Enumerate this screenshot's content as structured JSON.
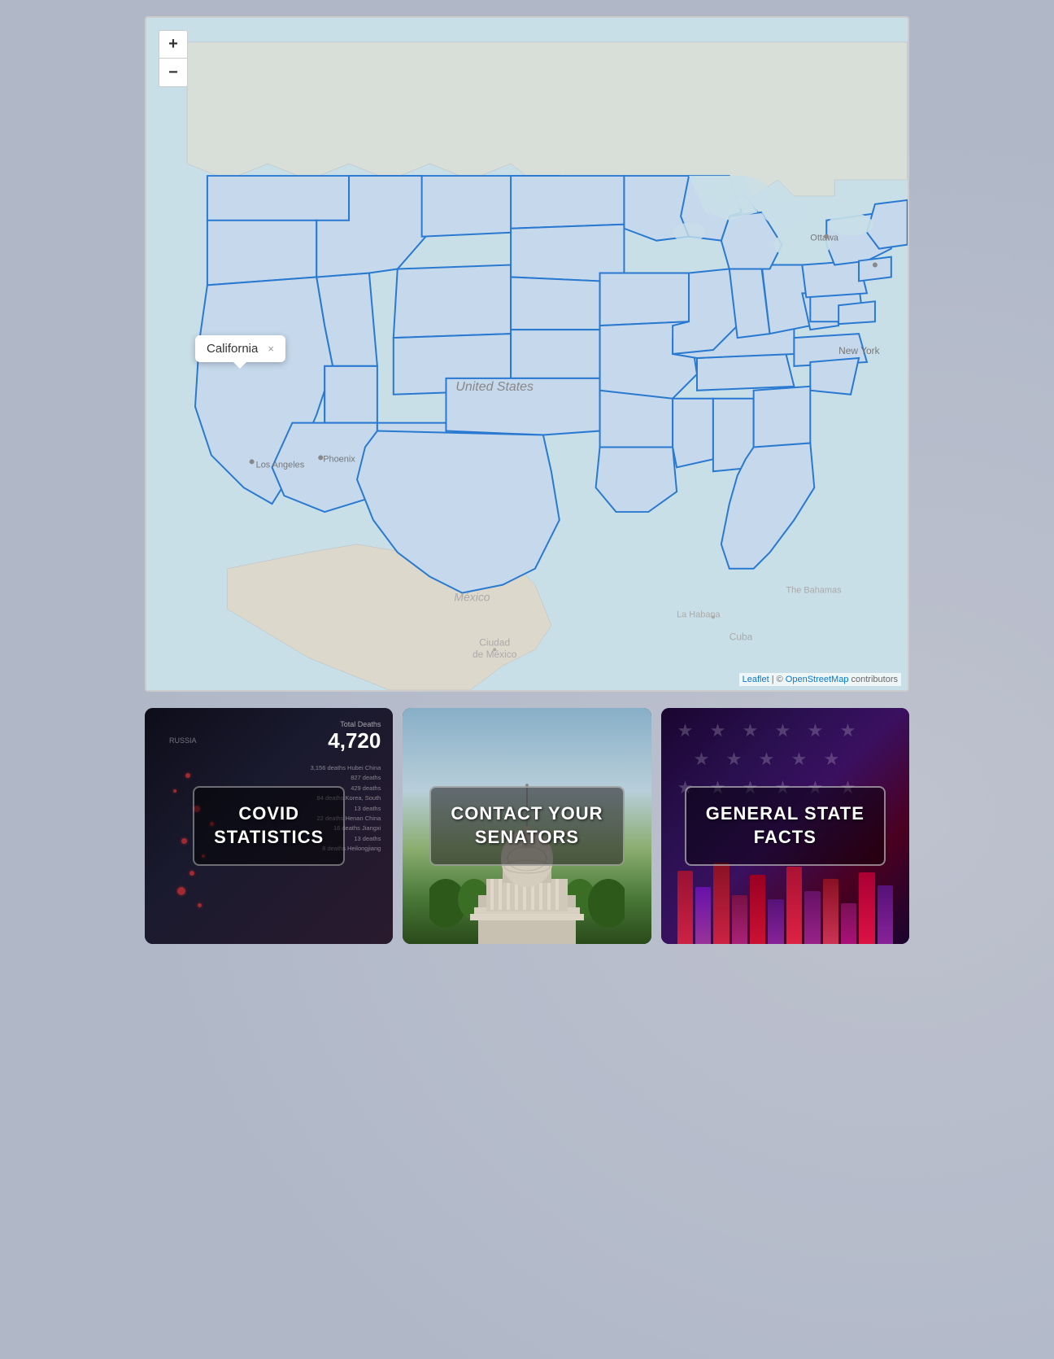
{
  "map": {
    "zoom_in_label": "+",
    "zoom_out_label": "−",
    "tooltip_state": "California",
    "tooltip_close": "×",
    "labels": {
      "united_states": "United States",
      "los_angeles": "Los Angeles",
      "phoenix": "Phoenix",
      "new_york": "New York",
      "ottawa": "Ottawa",
      "mexico": "México",
      "ciudad_de_mexico": "Ciudad\nde México",
      "la_habana": "La Habana",
      "cuba": "Cuba",
      "the_bahamas": "The Bahamas"
    },
    "attribution": {
      "leaflet": "Leaflet",
      "osm": "OpenStreetMap",
      "contributors": " contributors"
    }
  },
  "cards": [
    {
      "id": "covid",
      "title_line1": "COVID",
      "title_line2": "STATISTICS",
      "total_deaths_label": "Total Deaths",
      "total_deaths_value": "4,720",
      "stats": [
        "3,156 deaths Hubei China",
        "827 deaths",
        "429 deaths",
        "84 deaths Korea, South",
        "13 deaths",
        "22 deaths Henan China",
        "16 deaths Jiangxi",
        "13 deaths",
        "8 deaths Heilongjiang"
      ]
    },
    {
      "id": "senators",
      "title_line1": "CONTACT YOUR",
      "title_line2": "SENATORS"
    },
    {
      "id": "facts",
      "title_line1": "GENERAL STATE",
      "title_line2": "FACTS"
    }
  ],
  "stars": [
    "★",
    "★",
    "★",
    "★",
    "★",
    "★",
    "★",
    "★",
    "★",
    "★",
    "★",
    "★",
    "★",
    "★",
    "★",
    "★",
    "★",
    "★",
    "★",
    "★"
  ],
  "colors": {
    "map_ocean": "#c8dfe8",
    "map_land": "#e8e0d8",
    "states_fill": "#c5d8ec",
    "states_stroke": "#2979d0",
    "accent_blue": "#2979d0"
  }
}
